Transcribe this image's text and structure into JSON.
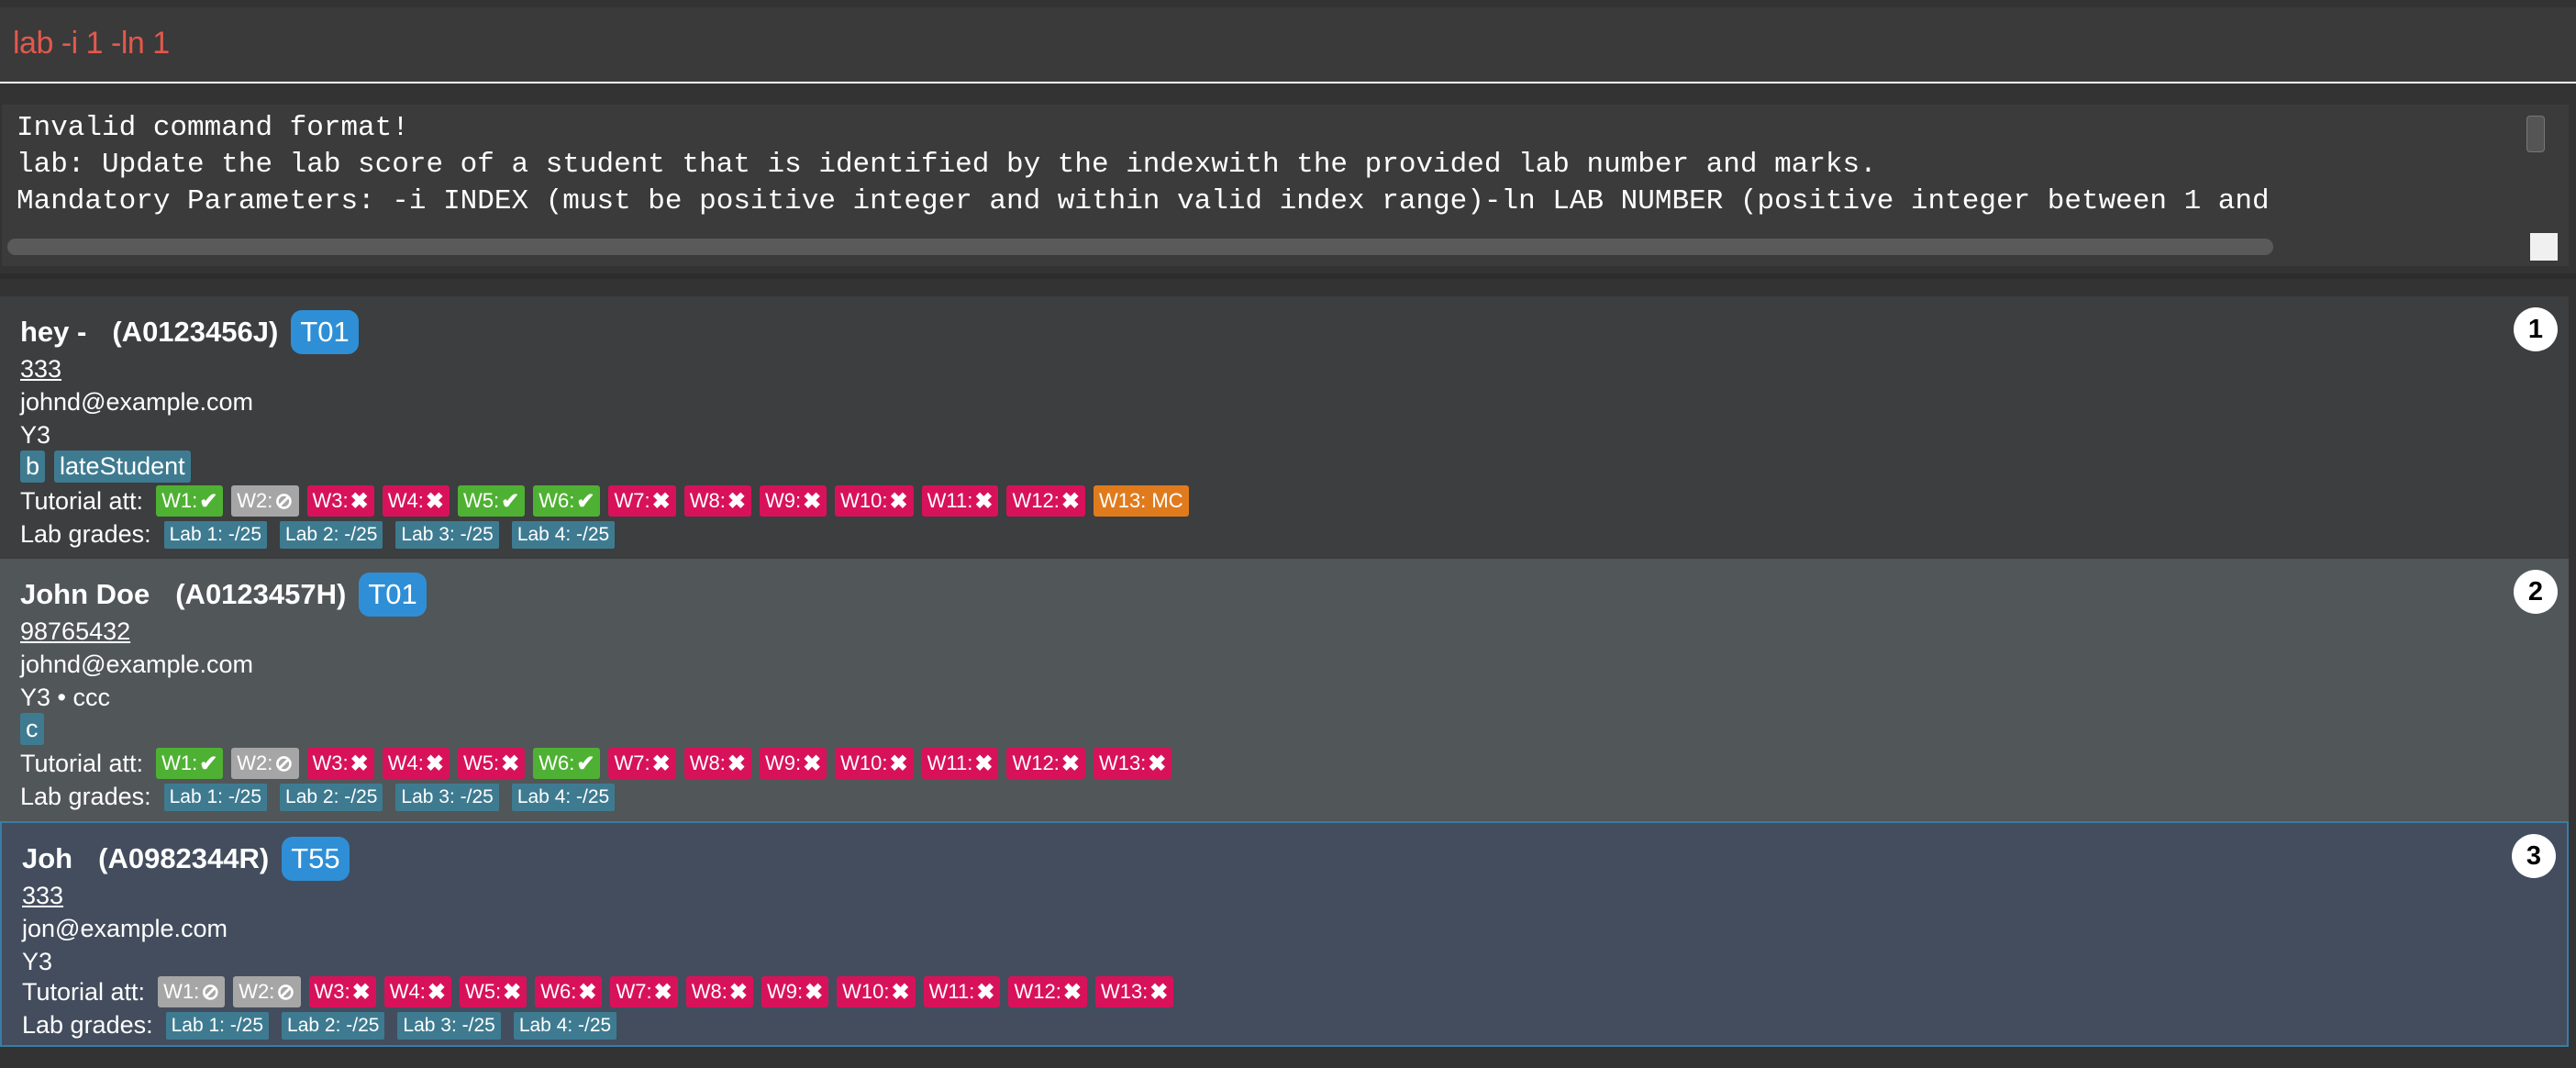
{
  "command": "lab -i 1 -ln 1",
  "result": [
    "Invalid command format!",
    "lab: Update the lab score of a student that is identified by the indexwith the provided lab number and marks.",
    "Mandatory Parameters: -i INDEX (must be positive integer and within valid index range)-ln LAB NUMBER (positive integer between 1 and"
  ],
  "labels": {
    "tutorial_att": "Tutorial att:",
    "lab_grades": "Lab grades:"
  },
  "status_colors": {
    "present": "#4fb133",
    "absent": "#d8125a",
    "na": "#a6a6a6",
    "mc": "#e07b1d"
  },
  "students": [
    {
      "index": "1",
      "name": "hey -",
      "id": "(A0123456J)",
      "tutorial": "T01",
      "phone": "333",
      "email": "johnd@example.com",
      "year": "Y3",
      "tags": [
        "b",
        "lateStudent"
      ],
      "attendance": [
        {
          "label": "W1:",
          "status": "present"
        },
        {
          "label": "W2:",
          "status": "na"
        },
        {
          "label": "W3:",
          "status": "absent"
        },
        {
          "label": "W4:",
          "status": "absent"
        },
        {
          "label": "W5:",
          "status": "present"
        },
        {
          "label": "W6:",
          "status": "present"
        },
        {
          "label": "W7:",
          "status": "absent"
        },
        {
          "label": "W8:",
          "status": "absent"
        },
        {
          "label": "W9:",
          "status": "absent"
        },
        {
          "label": "W10:",
          "status": "absent"
        },
        {
          "label": "W11:",
          "status": "absent"
        },
        {
          "label": "W12:",
          "status": "absent"
        },
        {
          "label": "W13: MC",
          "status": "mc"
        }
      ],
      "labs": [
        "Lab 1: -/25",
        "Lab 2: -/25",
        "Lab 3: -/25",
        "Lab 4: -/25"
      ]
    },
    {
      "index": "2",
      "name": "John Doe",
      "id": "(A0123457H)",
      "tutorial": "T01",
      "phone": "98765432",
      "email": "johnd@example.com",
      "year": "Y3 • ccc",
      "tags": [
        "c"
      ],
      "attendance": [
        {
          "label": "W1:",
          "status": "present"
        },
        {
          "label": "W2:",
          "status": "na"
        },
        {
          "label": "W3:",
          "status": "absent"
        },
        {
          "label": "W4:",
          "status": "absent"
        },
        {
          "label": "W5:",
          "status": "absent"
        },
        {
          "label": "W6:",
          "status": "present"
        },
        {
          "label": "W7:",
          "status": "absent"
        },
        {
          "label": "W8:",
          "status": "absent"
        },
        {
          "label": "W9:",
          "status": "absent"
        },
        {
          "label": "W10:",
          "status": "absent"
        },
        {
          "label": "W11:",
          "status": "absent"
        },
        {
          "label": "W12:",
          "status": "absent"
        },
        {
          "label": "W13:",
          "status": "absent"
        }
      ],
      "labs": [
        "Lab 1: -/25",
        "Lab 2: -/25",
        "Lab 3: -/25",
        "Lab 4: -/25"
      ]
    },
    {
      "index": "3",
      "name": "Joh",
      "id": "(A0982344R)",
      "tutorial": "T55",
      "phone": "333",
      "email": "jon@example.com",
      "year": "Y3",
      "tags": [],
      "attendance": [
        {
          "label": "W1:",
          "status": "na"
        },
        {
          "label": "W2:",
          "status": "na"
        },
        {
          "label": "W3:",
          "status": "absent"
        },
        {
          "label": "W4:",
          "status": "absent"
        },
        {
          "label": "W5:",
          "status": "absent"
        },
        {
          "label": "W6:",
          "status": "absent"
        },
        {
          "label": "W7:",
          "status": "absent"
        },
        {
          "label": "W8:",
          "status": "absent"
        },
        {
          "label": "W9:",
          "status": "absent"
        },
        {
          "label": "W10:",
          "status": "absent"
        },
        {
          "label": "W11:",
          "status": "absent"
        },
        {
          "label": "W12:",
          "status": "absent"
        },
        {
          "label": "W13:",
          "status": "absent"
        }
      ],
      "labs": [
        "Lab 1: -/25",
        "Lab 2: -/25",
        "Lab 3: -/25",
        "Lab 4: -/25"
      ]
    }
  ]
}
